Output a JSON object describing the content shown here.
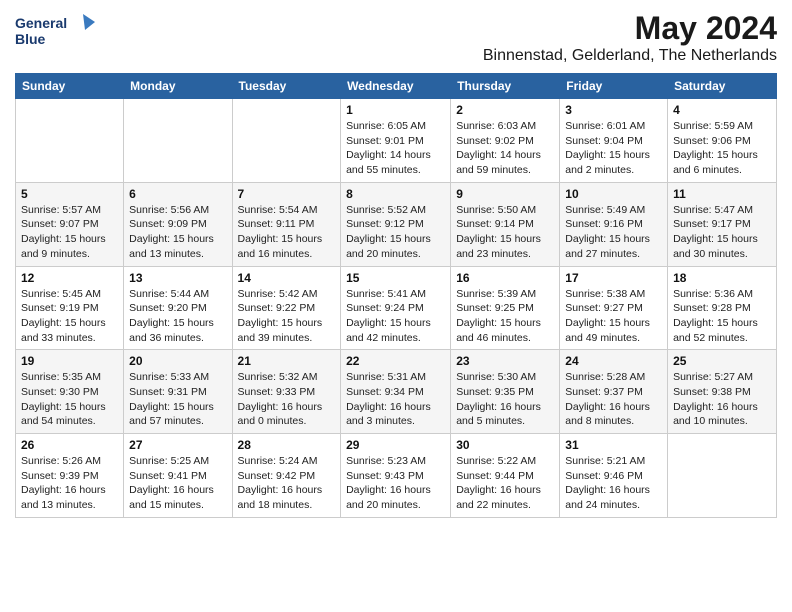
{
  "logo": {
    "line1": "General",
    "line2": "Blue"
  },
  "title": "May 2024",
  "subtitle": "Binnenstad, Gelderland, The Netherlands",
  "days_of_week": [
    "Sunday",
    "Monday",
    "Tuesday",
    "Wednesday",
    "Thursday",
    "Friday",
    "Saturday"
  ],
  "weeks": [
    [
      {
        "day": "",
        "info": ""
      },
      {
        "day": "",
        "info": ""
      },
      {
        "day": "",
        "info": ""
      },
      {
        "day": "1",
        "info": "Sunrise: 6:05 AM\nSunset: 9:01 PM\nDaylight: 14 hours\nand 55 minutes."
      },
      {
        "day": "2",
        "info": "Sunrise: 6:03 AM\nSunset: 9:02 PM\nDaylight: 14 hours\nand 59 minutes."
      },
      {
        "day": "3",
        "info": "Sunrise: 6:01 AM\nSunset: 9:04 PM\nDaylight: 15 hours\nand 2 minutes."
      },
      {
        "day": "4",
        "info": "Sunrise: 5:59 AM\nSunset: 9:06 PM\nDaylight: 15 hours\nand 6 minutes."
      }
    ],
    [
      {
        "day": "5",
        "info": "Sunrise: 5:57 AM\nSunset: 9:07 PM\nDaylight: 15 hours\nand 9 minutes."
      },
      {
        "day": "6",
        "info": "Sunrise: 5:56 AM\nSunset: 9:09 PM\nDaylight: 15 hours\nand 13 minutes."
      },
      {
        "day": "7",
        "info": "Sunrise: 5:54 AM\nSunset: 9:11 PM\nDaylight: 15 hours\nand 16 minutes."
      },
      {
        "day": "8",
        "info": "Sunrise: 5:52 AM\nSunset: 9:12 PM\nDaylight: 15 hours\nand 20 minutes."
      },
      {
        "day": "9",
        "info": "Sunrise: 5:50 AM\nSunset: 9:14 PM\nDaylight: 15 hours\nand 23 minutes."
      },
      {
        "day": "10",
        "info": "Sunrise: 5:49 AM\nSunset: 9:16 PM\nDaylight: 15 hours\nand 27 minutes."
      },
      {
        "day": "11",
        "info": "Sunrise: 5:47 AM\nSunset: 9:17 PM\nDaylight: 15 hours\nand 30 minutes."
      }
    ],
    [
      {
        "day": "12",
        "info": "Sunrise: 5:45 AM\nSunset: 9:19 PM\nDaylight: 15 hours\nand 33 minutes."
      },
      {
        "day": "13",
        "info": "Sunrise: 5:44 AM\nSunset: 9:20 PM\nDaylight: 15 hours\nand 36 minutes."
      },
      {
        "day": "14",
        "info": "Sunrise: 5:42 AM\nSunset: 9:22 PM\nDaylight: 15 hours\nand 39 minutes."
      },
      {
        "day": "15",
        "info": "Sunrise: 5:41 AM\nSunset: 9:24 PM\nDaylight: 15 hours\nand 42 minutes."
      },
      {
        "day": "16",
        "info": "Sunrise: 5:39 AM\nSunset: 9:25 PM\nDaylight: 15 hours\nand 46 minutes."
      },
      {
        "day": "17",
        "info": "Sunrise: 5:38 AM\nSunset: 9:27 PM\nDaylight: 15 hours\nand 49 minutes."
      },
      {
        "day": "18",
        "info": "Sunrise: 5:36 AM\nSunset: 9:28 PM\nDaylight: 15 hours\nand 52 minutes."
      }
    ],
    [
      {
        "day": "19",
        "info": "Sunrise: 5:35 AM\nSunset: 9:30 PM\nDaylight: 15 hours\nand 54 minutes."
      },
      {
        "day": "20",
        "info": "Sunrise: 5:33 AM\nSunset: 9:31 PM\nDaylight: 15 hours\nand 57 minutes."
      },
      {
        "day": "21",
        "info": "Sunrise: 5:32 AM\nSunset: 9:33 PM\nDaylight: 16 hours\nand 0 minutes."
      },
      {
        "day": "22",
        "info": "Sunrise: 5:31 AM\nSunset: 9:34 PM\nDaylight: 16 hours\nand 3 minutes."
      },
      {
        "day": "23",
        "info": "Sunrise: 5:30 AM\nSunset: 9:35 PM\nDaylight: 16 hours\nand 5 minutes."
      },
      {
        "day": "24",
        "info": "Sunrise: 5:28 AM\nSunset: 9:37 PM\nDaylight: 16 hours\nand 8 minutes."
      },
      {
        "day": "25",
        "info": "Sunrise: 5:27 AM\nSunset: 9:38 PM\nDaylight: 16 hours\nand 10 minutes."
      }
    ],
    [
      {
        "day": "26",
        "info": "Sunrise: 5:26 AM\nSunset: 9:39 PM\nDaylight: 16 hours\nand 13 minutes."
      },
      {
        "day": "27",
        "info": "Sunrise: 5:25 AM\nSunset: 9:41 PM\nDaylight: 16 hours\nand 15 minutes."
      },
      {
        "day": "28",
        "info": "Sunrise: 5:24 AM\nSunset: 9:42 PM\nDaylight: 16 hours\nand 18 minutes."
      },
      {
        "day": "29",
        "info": "Sunrise: 5:23 AM\nSunset: 9:43 PM\nDaylight: 16 hours\nand 20 minutes."
      },
      {
        "day": "30",
        "info": "Sunrise: 5:22 AM\nSunset: 9:44 PM\nDaylight: 16 hours\nand 22 minutes."
      },
      {
        "day": "31",
        "info": "Sunrise: 5:21 AM\nSunset: 9:46 PM\nDaylight: 16 hours\nand 24 minutes."
      },
      {
        "day": "",
        "info": ""
      }
    ]
  ]
}
